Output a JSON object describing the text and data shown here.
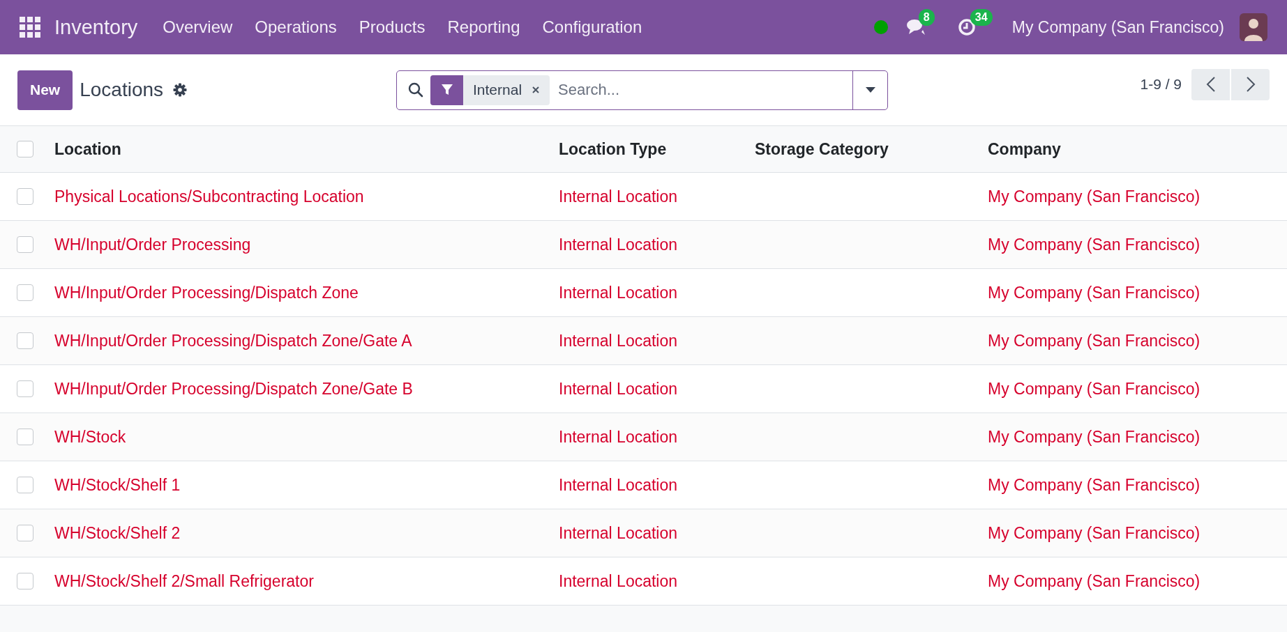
{
  "navbar": {
    "app_name": "Inventory",
    "menu": [
      "Overview",
      "Operations",
      "Products",
      "Reporting",
      "Configuration"
    ],
    "messages_count": "8",
    "activities_count": "34",
    "company": "My Company (San Francisco)"
  },
  "control_panel": {
    "new_button": "New",
    "title": "Locations",
    "filter_facet": "Internal",
    "search": {
      "placeholder": "Search..."
    },
    "pager": "1-9 / 9"
  },
  "table": {
    "select_all_checked": false,
    "columns": [
      "Location",
      "Location Type",
      "Storage Category",
      "Company"
    ],
    "rows": [
      {
        "checked": false,
        "location": "Physical Locations/Subcontracting Location",
        "location_type": "Internal Location",
        "company": "My Company (San Francisco)"
      },
      {
        "checked": false,
        "location": "WH/Input/Order Processing",
        "location_type": "Internal Location",
        "company": "My Company (San Francisco)"
      },
      {
        "checked": false,
        "location": "WH/Input/Order Processing/Dispatch Zone",
        "location_type": "Internal Location",
        "company": "My Company (San Francisco)"
      },
      {
        "checked": false,
        "location": "WH/Input/Order Processing/Dispatch Zone/Gate A",
        "location_type": "Internal Location",
        "company": "My Company (San Francisco)"
      },
      {
        "checked": false,
        "location": "WH/Input/Order Processing/Dispatch Zone/Gate B",
        "location_type": "Internal Location",
        "company": "My Company (San Francisco)"
      },
      {
        "checked": false,
        "location": "WH/Stock",
        "location_type": "Internal Location",
        "company": "My Company (San Francisco)"
      },
      {
        "checked": false,
        "location": "WH/Stock/Shelf 1",
        "location_type": "Internal Location",
        "company": "My Company (San Francisco)"
      },
      {
        "checked": false,
        "location": "WH/Stock/Shelf 2",
        "location_type": "Internal Location",
        "company": "My Company (San Francisco)"
      },
      {
        "checked": false,
        "location": "WH/Stock/Shelf 2/Small Refrigerator",
        "location_type": "Internal Location",
        "company": "My Company (San Francisco)"
      }
    ]
  }
}
